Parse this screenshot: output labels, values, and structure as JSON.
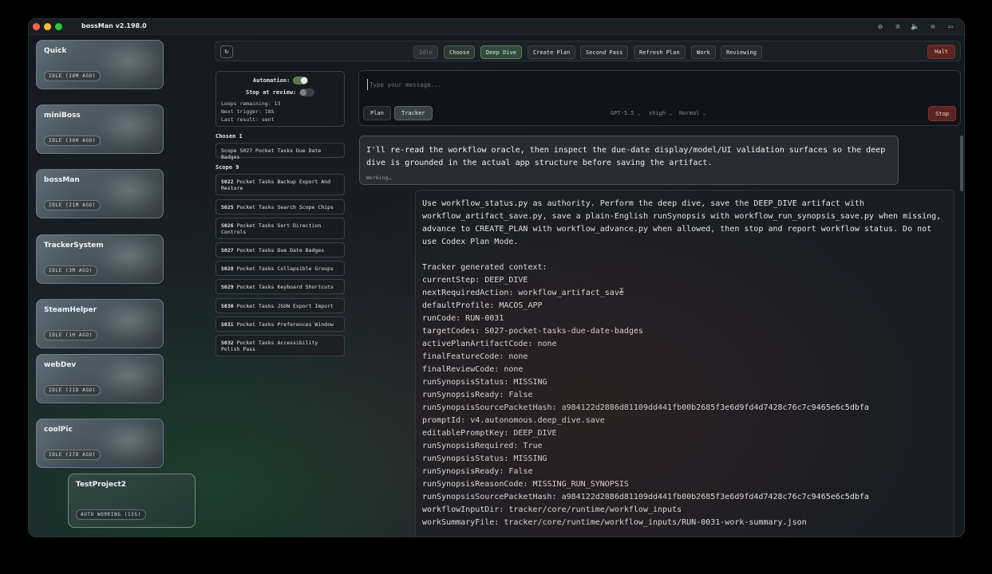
{
  "app": {
    "title": "bossMan v2.198.0"
  },
  "titlebar_icons": [
    "gear-icon",
    "list-icon",
    "speaker-icon",
    "minus-circle-icon",
    "chat-icon"
  ],
  "projects": [
    {
      "name": "Quick",
      "status": "IDLE (28M AGO)"
    },
    {
      "name": "miniBoss",
      "status": "IDLE (30M AGO)"
    },
    {
      "name": "bossMan",
      "status": "IDLE (21M AGO)"
    },
    {
      "name": "TrackerSystem",
      "status": "IDLE (3M AGO)"
    },
    {
      "name": "SteamHelper",
      "status": "IDLE (1H AGO)"
    },
    {
      "name": "webDev",
      "status": "IDLE (21D AGO)"
    },
    {
      "name": "coolPic",
      "status": "IDLE (27D AGO)"
    },
    {
      "name": "TestProject2",
      "status": "AUTO WORKING (13S)"
    }
  ],
  "toolbar": {
    "steps": [
      "Idle",
      "Choose",
      "Deep Dive",
      "Create Plan",
      "Second Pass",
      "Refresh Plan",
      "Work",
      "Reviewing"
    ],
    "halt": "Halt"
  },
  "automation": {
    "automation_label": "Automation:",
    "automation_on": true,
    "stop_label": "Stop at review:",
    "stop_on": false,
    "loops": "Loops remaining: 13",
    "next_trigger": "Next trigger: 18S",
    "last_result": "Last result: sent"
  },
  "chosen": {
    "label": "Chosen 1",
    "items": [
      {
        "code": "",
        "text": "Scope S027 Pocket Tasks Due Date Badges"
      }
    ]
  },
  "scope": {
    "label": "Scope 9",
    "items": [
      {
        "code": "S022",
        "text": "Pocket Tasks Backup Export And Restore"
      },
      {
        "code": "S025",
        "text": "Pocket Tasks Search Scope Chips"
      },
      {
        "code": "S026",
        "text": "Pocket Tasks Sort Direction Controls"
      },
      {
        "code": "S027",
        "text": "Pocket Tasks Due Date Badges"
      },
      {
        "code": "S028",
        "text": "Pocket Tasks Collapsible Groups"
      },
      {
        "code": "S029",
        "text": "Pocket Tasks Keyboard Shortcuts"
      },
      {
        "code": "S030",
        "text": "Pocket Tasks JSON Export Import"
      },
      {
        "code": "S031",
        "text": "Pocket Tasks Preferences Window"
      },
      {
        "code": "S032",
        "text": "Pocket Tasks Accessibility Polish Pass"
      }
    ]
  },
  "composer": {
    "placeholder": "Type your message...",
    "plan": "Plan",
    "tracker": "Tracker",
    "model": "GPT-5.5",
    "effort": "xhigh",
    "speed": "Normal",
    "stop": "Stop"
  },
  "messages": {
    "assistant": "I'll re-read the workflow oracle, then inspect the due-date display/model/UI validation surfaces so the deep dive is grounded in the actual app structure before saving the artifact.",
    "working": "Working…",
    "user": "Use workflow_status.py as authority. Perform the deep dive, save the DEEP_DIVE artifact with workflow_artifact_save.py, save a plain-English runSynopsis with workflow_run_synopsis_save.py when missing, advance to CREATE_PLAN with workflow_advance.py when allowed, then stop and report workflow status. Do not use Codex Plan Mode.\n\nTracker generated context:\ncurrentStep: DEEP_DIVE\nnextRequiredAction: workflow_artifact_save\ndefaultProfile: MACOS_APP\nrunCode: RUN-0031\ntargetCodes: S027-pocket-tasks-due-date-badges\nactivePlanArtifactCode: none\nfinalFeatureCode: none\nfinalReviewCode: none\nrunSynopsisStatus: MISSING\nrunSynopsisReady: False\nrunSynopsisSourcePacketHash: a984122d2886d81109dd441fb00b2685f3e6d9fd4d7428c76c7c9465e6c5dbfa\npromptId: v4.autonomous.deep_dive.save\neditablePromptKey: DEEP_DIVE\nrunSynopsisRequired: True\nrunSynopsisStatus: MISSING\nrunSynopsisReady: False\nrunSynopsisReasonCode: MISSING_RUN_SYNOPSIS\nrunSynopsisSourcePacketHash: a984122d2886d81109dd441fb00b2685f3e6d9fd4d7428c76c7c9465e6c5dbfa\nworkflowInputDir: tracker/core/runtime/workflow_inputs\nworkSummaryFile: tracker/core/runtime/workflow_inputs/RUN-0031-work-summary.json"
  }
}
